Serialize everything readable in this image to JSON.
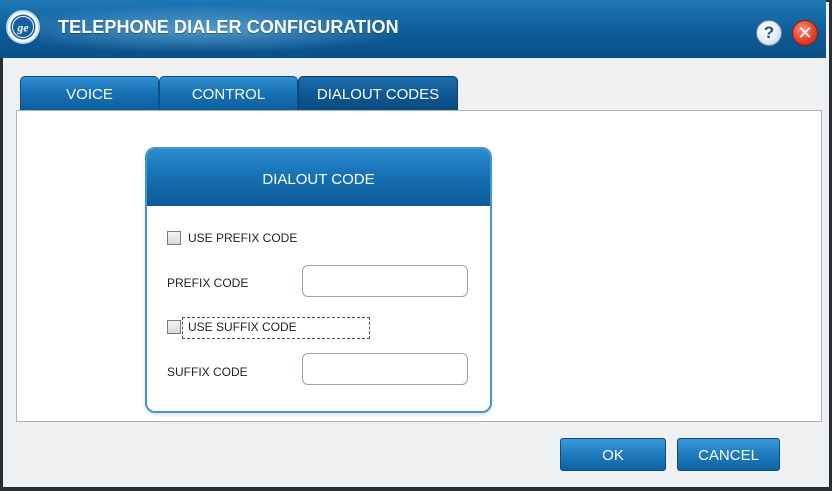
{
  "window": {
    "title": "TELEPHONE DIALER CONFIGURATION",
    "help_icon_glyph": "?",
    "close_icon_glyph": "✕"
  },
  "tabs": [
    {
      "label": "VOICE",
      "active": false
    },
    {
      "label": "CONTROL",
      "active": false
    },
    {
      "label": "DIALOUT CODES",
      "active": true
    }
  ],
  "panel": {
    "title": "DIALOUT CODE",
    "use_prefix": {
      "label": "USE PREFIX CODE",
      "checked": false
    },
    "prefix": {
      "label": "PREFIX CODE",
      "value": ""
    },
    "use_suffix": {
      "label": "USE SUFFIX CODE",
      "checked": false
    },
    "suffix": {
      "label": "SUFFIX CODE",
      "value": ""
    }
  },
  "buttons": {
    "ok": "OK",
    "cancel": "CANCEL"
  },
  "colors": {
    "accent": "#1670b2",
    "close": "#e3412b"
  },
  "icons": [
    "ge-logo-icon",
    "help-icon",
    "close-icon"
  ]
}
